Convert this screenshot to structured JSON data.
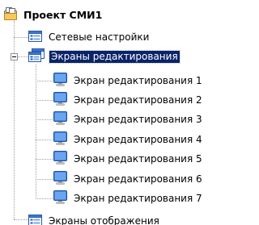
{
  "tree": {
    "root": {
      "label": "Проект СМИ1",
      "icon": "project-icon"
    },
    "network": {
      "label": "Сетевые настройки",
      "icon": "settings-page-icon"
    },
    "edit_screens": {
      "label": "Экраны редактирования",
      "icon": "screens-folder-icon",
      "expanded": true,
      "selected": true,
      "items": [
        {
          "label": "Экран редактирования 1",
          "icon": "monitor-icon"
        },
        {
          "label": "Экран редактирования 2",
          "icon": "monitor-icon"
        },
        {
          "label": "Экран редактирования 3",
          "icon": "monitor-icon"
        },
        {
          "label": "Экран редактирования 4",
          "icon": "monitor-icon"
        },
        {
          "label": "Экран редактирования 5",
          "icon": "monitor-icon"
        },
        {
          "label": "Экран редактирования 6",
          "icon": "monitor-icon"
        },
        {
          "label": "Экран редактирования 7",
          "icon": "monitor-icon"
        }
      ]
    },
    "display_screens": {
      "label": "Экраны отображения",
      "icon": "screens-folder-icon"
    }
  },
  "colors": {
    "selection_bg": "#0a246a",
    "selection_fg": "#ffffff",
    "monitor_blue": "#2f6fd0"
  }
}
